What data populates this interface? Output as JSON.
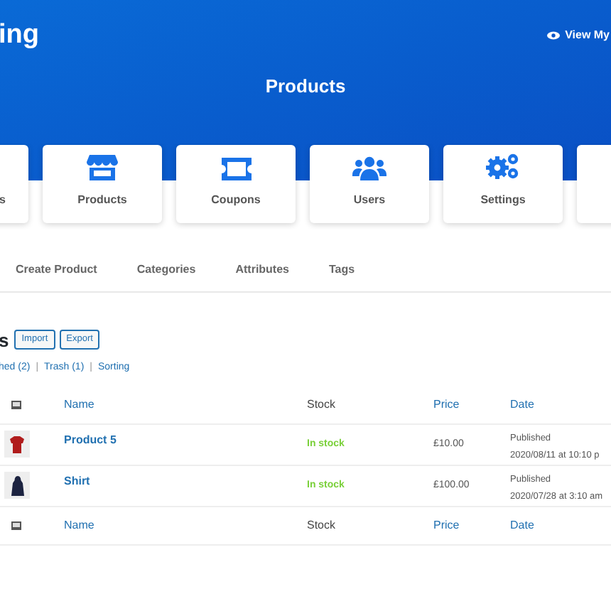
{
  "header": {
    "brand": "ing",
    "view_link": "View My",
    "title": "Products"
  },
  "cards": [
    {
      "label": "s",
      "kind": "partial"
    },
    {
      "label": "Products",
      "kind": "store"
    },
    {
      "label": "Coupons",
      "kind": "ticket"
    },
    {
      "label": "Users",
      "kind": "users"
    },
    {
      "label": "Settings",
      "kind": "gears"
    }
  ],
  "tabs": [
    {
      "label": "Create Product"
    },
    {
      "label": "Categories"
    },
    {
      "label": "Attributes"
    },
    {
      "label": "Tags"
    }
  ],
  "list": {
    "title": "s",
    "buttons": [
      "Import",
      "Export"
    ],
    "filters": [
      {
        "kind": "link",
        "text": "hed (2)"
      },
      {
        "kind": "separator",
        "text": "|"
      },
      {
        "kind": "link",
        "text": "Trash (1)"
      },
      {
        "kind": "separator",
        "text": "|"
      },
      {
        "kind": "link",
        "text": "Sorting"
      }
    ],
    "columns": [
      "Name",
      "Stock",
      "Price",
      "Date"
    ],
    "rows": [
      {
        "kind": "tshirt",
        "name": "Product 5",
        "stock": "In stock",
        "price": "£10.00",
        "status": "Published",
        "date": "2020/08/11 at 10:10 p"
      },
      {
        "kind": "hoodie",
        "name": "Shirt",
        "stock": "In stock",
        "price": "£100.00",
        "status": "Published",
        "date": "2020/07/28 at 3:10 am"
      }
    ],
    "footer_columns": [
      "Name",
      "Stock",
      "Price",
      "Date"
    ]
  }
}
